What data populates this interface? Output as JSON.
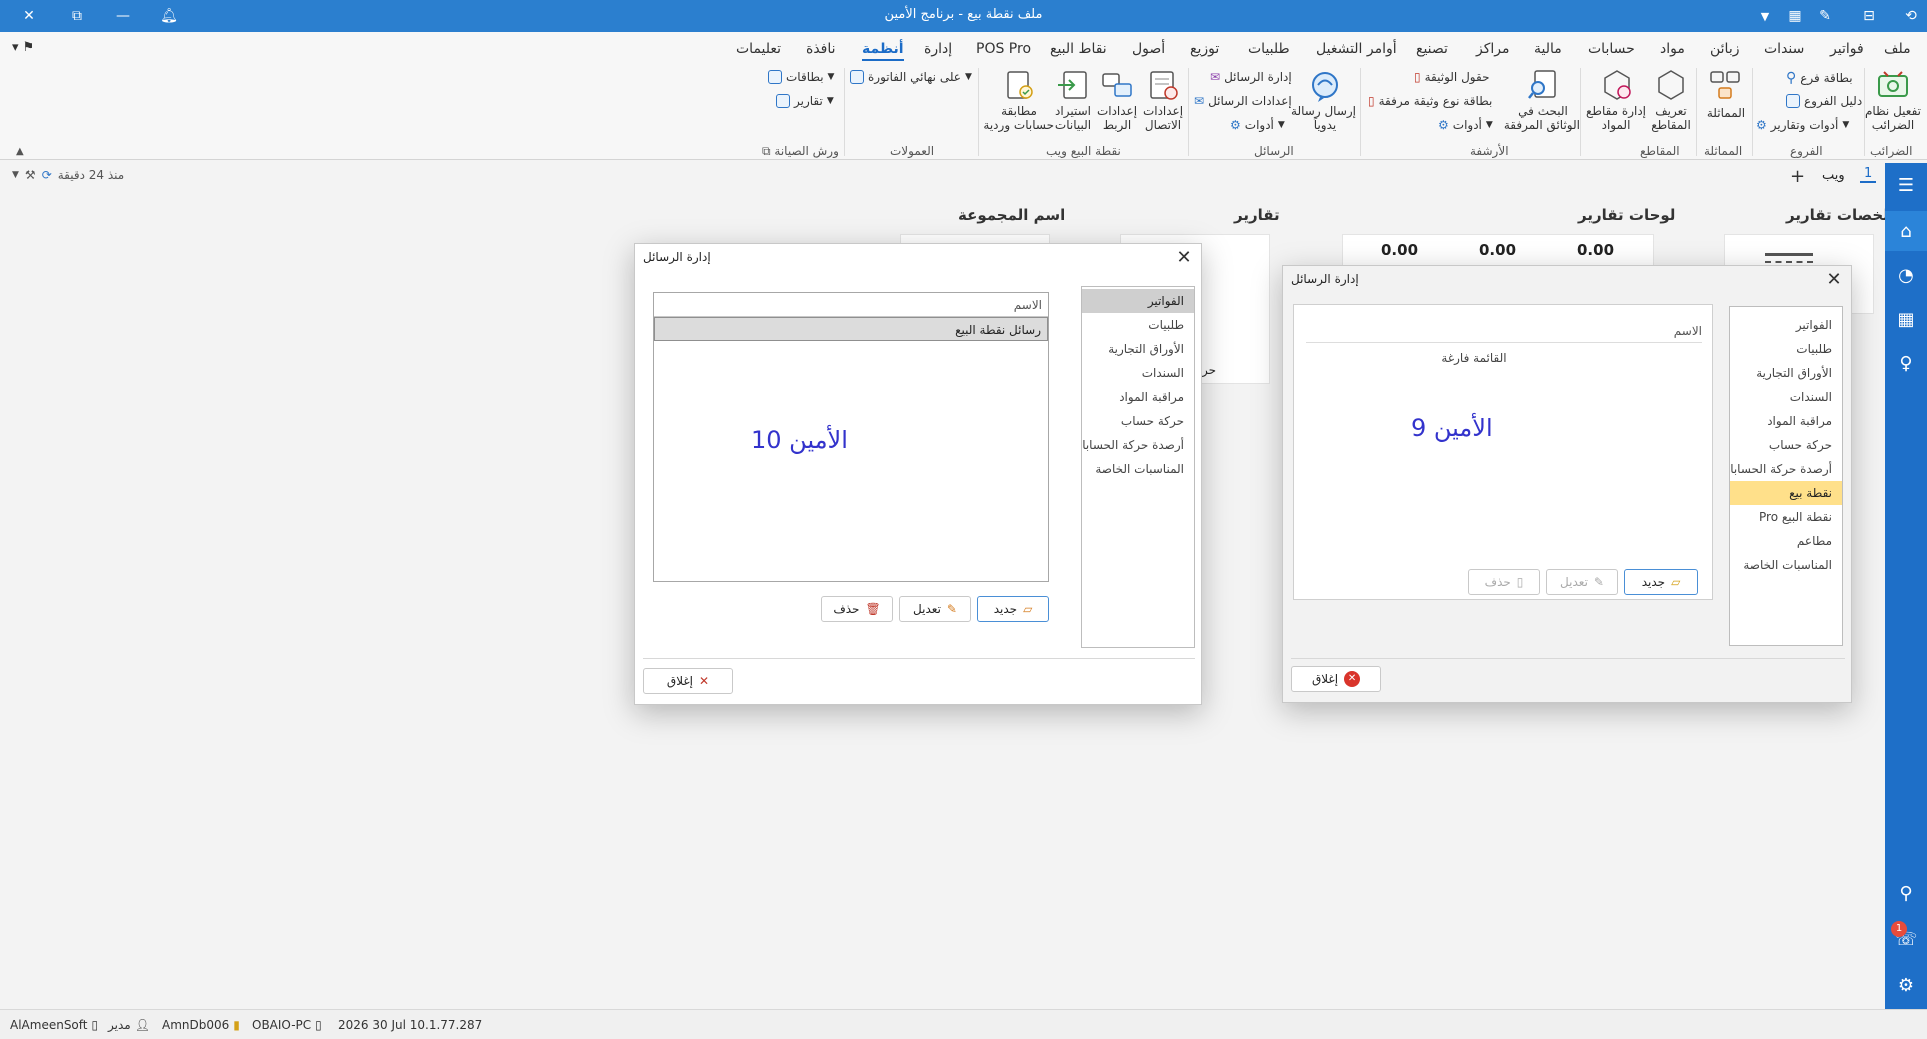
{
  "window": {
    "title": "ملف نقطة بيع - برنامج الأمين"
  },
  "menu": {
    "tabs": [
      "ملف",
      "فواتير",
      "سندات",
      "زبائن",
      "مواد",
      "حسابات",
      "مالية",
      "مراكز",
      "تصنيع",
      "أوامر التشغيل",
      "طلبيات",
      "توزيع",
      "أصول",
      "نقاط البيع",
      "POS Pro",
      "إدارة",
      "أنظمة",
      "نافذة",
      "تعليمات"
    ],
    "active": "أنظمة"
  },
  "ribbon": {
    "taxes": {
      "btn1": "تفعيل نظام",
      "btn1b": "الضرائب",
      "group": "الضرائب"
    },
    "branches": {
      "item1": "بطاقة فرع",
      "item2": "دليل الفروع",
      "item3": "أدوات وتقارير",
      "group": "الفروع"
    },
    "similarity": {
      "btn": "المماثلة",
      "group": "المماثلة"
    },
    "sections": {
      "btn1": "تعريف",
      "btn1b": "المقاطع",
      "btn2": "إدارة مقاطع",
      "btn2b": "المواد",
      "group": "المقاطع"
    },
    "archive": {
      "btn": "البحث في",
      "btnb": "الوثائق المرفقة",
      "item1": "حقول الوثيقة",
      "item2": "بطاقة نوع وثيقة مرفقة",
      "item3": "أدوات",
      "group": "الأرشفة"
    },
    "messages": {
      "btn": "إرسال رسالة",
      "btnb": "يدوياً",
      "item1": "إدارة الرسائل",
      "item2": "إعدادات الرسائل",
      "item3": "أدوات",
      "group": "الرسائل"
    },
    "pos_web": {
      "btn1": "إعدادات",
      "btn1b": "الاتصال",
      "btn2": "إعدادات",
      "btn2b": "الربط",
      "btn3": "استيراد",
      "btn3b": "البيانات",
      "btn4": "مطابقة",
      "btn4b": "حسابات وردية",
      "group": "نقطة البيع ويب"
    },
    "commissions": {
      "item1": "على نهائي الفاتورة",
      "group": "العمولات"
    },
    "maintenance": {
      "item1": "بطاقات",
      "item2": "تقارير",
      "group": "ورش الصيانة"
    }
  },
  "subbar": {
    "page": "1",
    "web": "ويب",
    "updated": "منذ 24 دقيقة"
  },
  "dashboard": {
    "headings": [
      "ملخصات تقارير",
      "لوحات تقارير",
      "تقارير",
      "اسم المجموعة"
    ],
    "values": [
      "0.00",
      "0.00",
      "0.00"
    ],
    "card_label": "حركة إجمالي"
  },
  "dialog_left": {
    "title": "إدارة الرسائل",
    "categories": [
      "الفواتير",
      "طلبيات",
      "الأوراق التجارية",
      "السندات",
      "مراقبة المواد",
      "حركة حساب",
      "أرصدة حركة الحسابات",
      "المناسبات الخاصة"
    ],
    "grid_header": "الاسم",
    "rows": [
      "رسائل نقطة البيع"
    ],
    "watermark": "الأمين 10",
    "btn_new": "جديد",
    "btn_edit": "تعديل",
    "btn_delete": "حذف",
    "btn_close": "إغلاق"
  },
  "dialog_right": {
    "title": "إدارة الرسائل",
    "categories": [
      "الفواتير",
      "طلبيات",
      "الأوراق التجارية",
      "السندات",
      "مراقبة المواد",
      "حركة حساب",
      "أرصدة حركة الحسابات",
      "نقطة بيع",
      "نقطة البيع Pro",
      "مطاعم",
      "المناسبات الخاصة"
    ],
    "grid_header": "الاسم",
    "empty": "القائمة فارغة",
    "watermark": "الأمين 9",
    "btn_new": "جديد",
    "btn_edit": "تعديل",
    "btn_delete": "حذف",
    "btn_close": "إغلاق"
  },
  "status": {
    "company": "AlAmeenSoft",
    "user": "مدير",
    "db": "AmnDb006",
    "pc": "OBAIO-PC",
    "date": "2026 30 Jul 10.1.77.287"
  },
  "notify_badge": "1",
  "colors": {
    "accent": "#2b7fcf",
    "sidebar": "#1e6fc8",
    "highlight": "#ffe08a",
    "watermark": "#3333cc"
  }
}
